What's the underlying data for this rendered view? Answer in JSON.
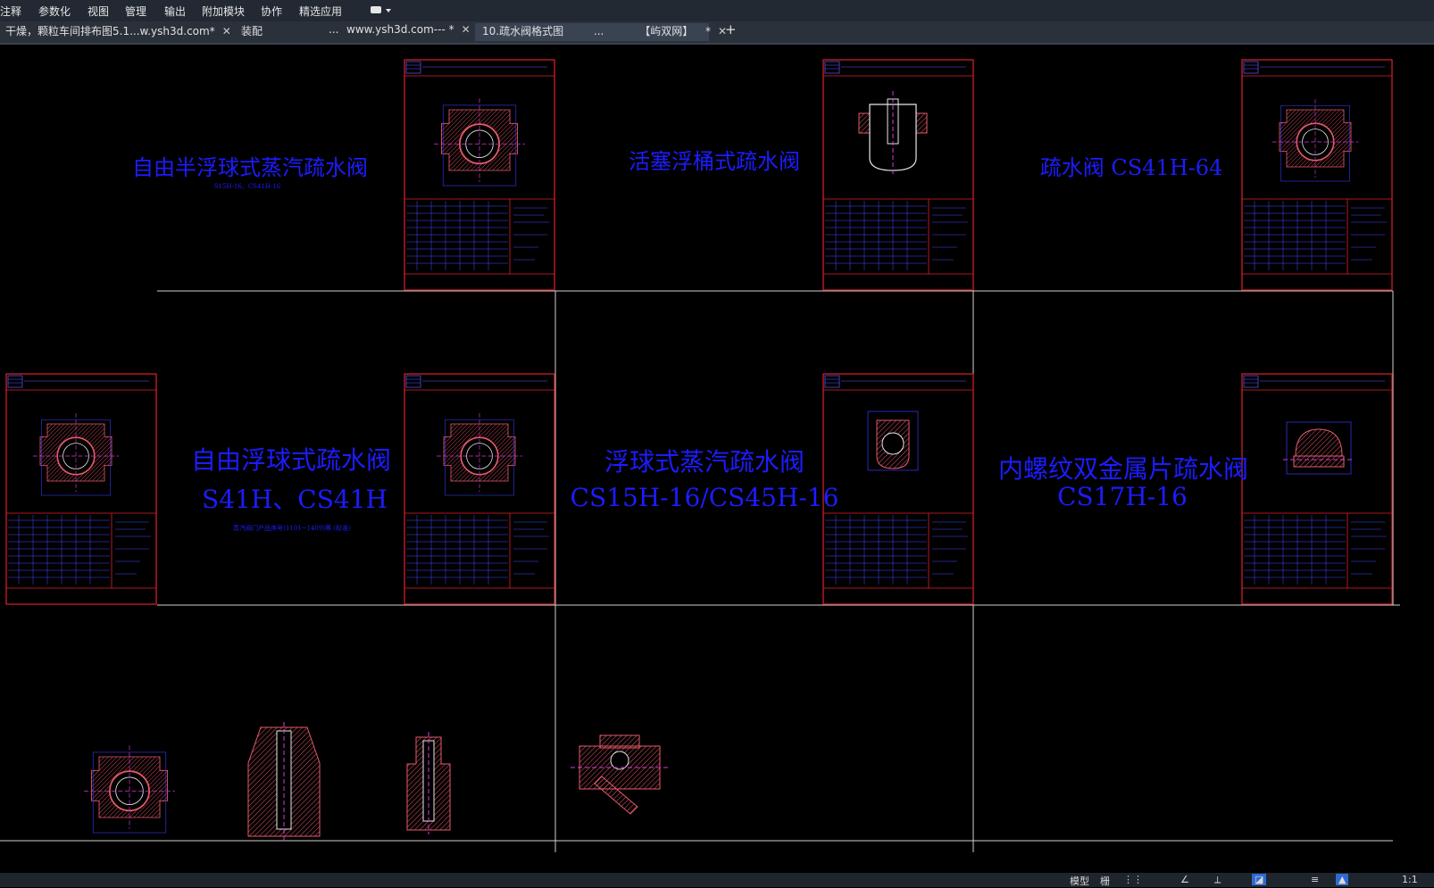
{
  "menu": {
    "items": [
      "注释",
      "参数化",
      "视图",
      "管理",
      "输出",
      "附加模块",
      "协作",
      "精选应用"
    ]
  },
  "tabs": [
    {
      "label": "干燥，颗粒车间排布图5.1...w.ysh3d.com*"
    },
    {
      "label": "装配"
    },
    {
      "label": "..."
    },
    {
      "label": "www.ysh3d.com--- *"
    },
    {
      "label": "10.疏水阀格式图"
    },
    {
      "label": "..."
    },
    {
      "label": "【屿双网】"
    },
    {
      "label": "*"
    }
  ],
  "add_tab": "+",
  "canvas": {
    "labels": {
      "title1": "自由半浮球式蒸汽疏水阀",
      "subtitle1": "S15H-16、CS41H-16",
      "title2": "活塞浮桶式疏水阀",
      "title3": "疏水阀 CS41H-64",
      "title4_line1": "自由浮球式疏水阀",
      "title4_line2": "S41H、CS41H",
      "subtitle4": "蒸汽阀门产品序号(1101~1409)等 (标准)",
      "title5_line1": "浮球式蒸汽疏水阀",
      "title5_line2": "CS15H-16/CS45H-16",
      "title6_line1": "内螺纹双金属片疏水阀",
      "title6_line2": "CS17H-16"
    }
  },
  "status": {
    "model": "模型",
    "grid": "栅",
    "snap": "⋮⋮",
    "scale": "1:1"
  },
  "colors": {
    "frame": "#e0202a",
    "blue_text": "#1c1cff",
    "section_line": "#d0d0d0",
    "part_red": "#e85a6a",
    "part_white": "#e8e8e8",
    "part_magenta": "#d83ad8"
  }
}
